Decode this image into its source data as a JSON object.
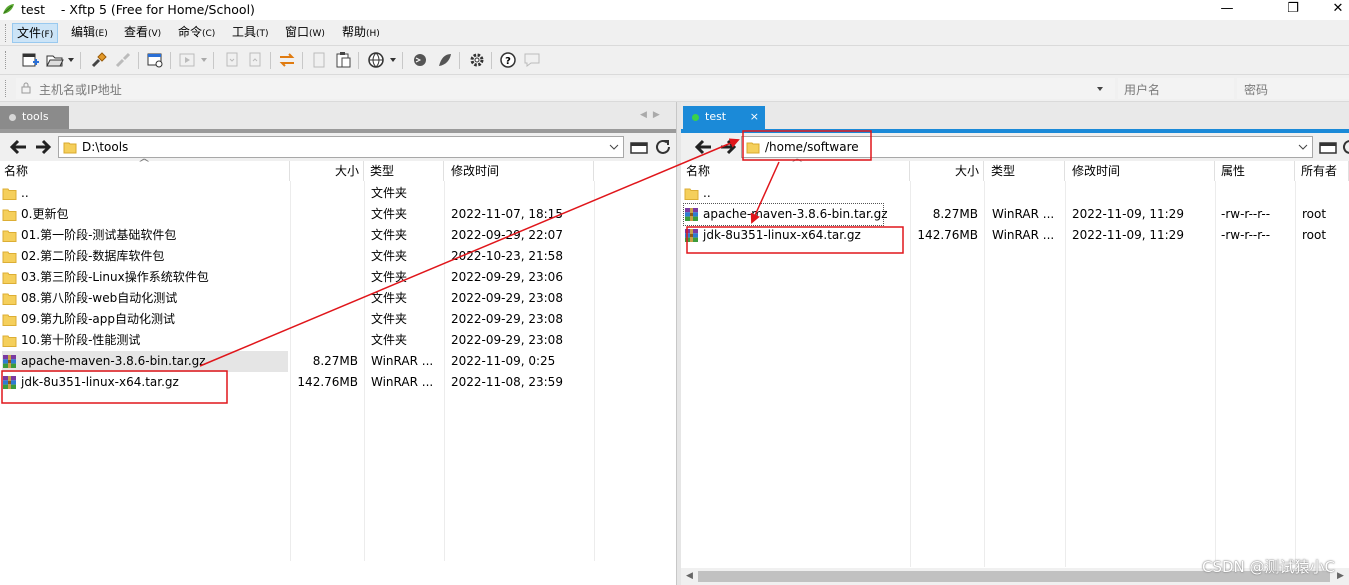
{
  "window": {
    "session_name": "test",
    "title": "- Xftp 5 (Free for Home/School)",
    "minimize": "—",
    "maximize": "❐",
    "close": "✕"
  },
  "menu": {
    "items": [
      {
        "label": "文件",
        "key": "(F)"
      },
      {
        "label": "编辑",
        "key": "(E)"
      },
      {
        "label": "查看",
        "key": "(V)"
      },
      {
        "label": "命令",
        "key": "(C)"
      },
      {
        "label": "工具",
        "key": "(T)"
      },
      {
        "label": "窗口",
        "key": "(W)"
      },
      {
        "label": "帮助",
        "key": "(H)"
      }
    ]
  },
  "toolbar": {
    "icons": [
      "new-session-icon",
      "open-folder-icon",
      "connect-icon",
      "disconnect-icon",
      "new-window-icon",
      "play-icon",
      "copy-icon",
      "paste-icon",
      "transfer-icon",
      "document-icon",
      "clipboard-icon",
      "globe-icon",
      "xshell-icon",
      "xmanager-icon",
      "gear-icon",
      "help-icon",
      "chat-icon"
    ]
  },
  "address": {
    "host_placeholder": "主机名或IP地址",
    "user_placeholder": "用户名",
    "password_placeholder": "密码"
  },
  "left": {
    "tab_label": "tools",
    "tab_close": "×",
    "path": "D:\\tools",
    "columns": {
      "name": "名称",
      "size": "大小",
      "type": "类型",
      "modified": "修改时间"
    },
    "rows": [
      {
        "name": "..",
        "size": "",
        "type": "文件夹",
        "modified": "",
        "kind": "folder"
      },
      {
        "name": "0.更新包",
        "size": "",
        "type": "文件夹",
        "modified": "2022-11-07, 18:15",
        "kind": "folder"
      },
      {
        "name": "01.第一阶段-测试基础软件包",
        "size": "",
        "type": "文件夹",
        "modified": "2022-09-29, 22:07",
        "kind": "folder"
      },
      {
        "name": "02.第二阶段-数据库软件包",
        "size": "",
        "type": "文件夹",
        "modified": "2022-10-23, 21:58",
        "kind": "folder"
      },
      {
        "name": "03.第三阶段-Linux操作系统软件包",
        "size": "",
        "type": "文件夹",
        "modified": "2022-09-29, 23:06",
        "kind": "folder"
      },
      {
        "name": "08.第八阶段-web自动化测试",
        "size": "",
        "type": "文件夹",
        "modified": "2022-09-29, 23:08",
        "kind": "folder"
      },
      {
        "name": "09.第九阶段-app自动化测试",
        "size": "",
        "type": "文件夹",
        "modified": "2022-09-29, 23:08",
        "kind": "folder"
      },
      {
        "name": "10.第十阶段-性能测试",
        "size": "",
        "type": "文件夹",
        "modified": "2022-09-29, 23:08",
        "kind": "folder"
      },
      {
        "name": "apache-maven-3.8.6-bin.tar.gz",
        "size": "8.27MB",
        "type": "WinRAR ...",
        "modified": "2022-11-09, 0:25",
        "kind": "archive"
      },
      {
        "name": "jdk-8u351-linux-x64.tar.gz",
        "size": "142.76MB",
        "type": "WinRAR ...",
        "modified": "2022-11-08, 23:59",
        "kind": "archive"
      }
    ]
  },
  "right": {
    "tab_label": "test",
    "tab_close": "×",
    "path": "/home/software",
    "columns": {
      "name": "名称",
      "size": "大小",
      "type": "类型",
      "modified": "修改时间",
      "attr": "属性",
      "owner": "所有者"
    },
    "rows": [
      {
        "name": "..",
        "size": "",
        "type": "",
        "modified": "",
        "attr": "",
        "owner": "",
        "kind": "folder"
      },
      {
        "name": "apache-maven-3.8.6-bin.tar.gz",
        "size": "8.27MB",
        "type": "WinRAR ...",
        "modified": "2022-11-09, 11:29",
        "attr": "-rw-r--r--",
        "owner": "root",
        "kind": "archive"
      },
      {
        "name": "jdk-8u351-linux-x64.tar.gz",
        "size": "142.76MB",
        "type": "WinRAR ...",
        "modified": "2022-11-09, 11:29",
        "attr": "-rw-r--r--",
        "owner": "root",
        "kind": "archive"
      }
    ]
  },
  "annotation_color": "#e0161b",
  "accent_color": "#1b8ad8",
  "watermark": "CSDN @测试猿小C"
}
